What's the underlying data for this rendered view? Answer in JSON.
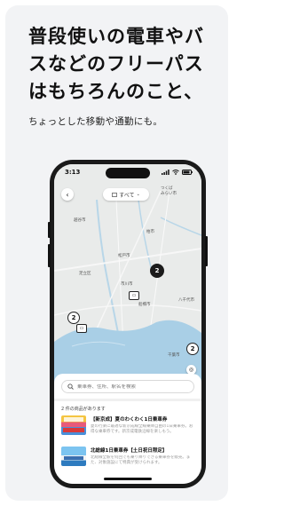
{
  "headline": {
    "line1": "普段使いの電車やバ",
    "line2": "スなどのフリーパス",
    "line3": "はもちろんのこと、"
  },
  "subline": "ちょっとした移動や通勤にも。",
  "phone": {
    "status_time": "3:13",
    "filter_label": "すべて",
    "map_places": {
      "tsukuba": "つくば\nみらい市",
      "koshigaya": "越谷市",
      "kashiwa": "柏市",
      "matsudo": "松戸市",
      "adachi": "足立区",
      "ichikawa": "市川市",
      "funabashi": "船橋市",
      "yachiyo": "八千代市",
      "chiba": "千葉市"
    },
    "clusters": [
      "2",
      "2",
      "2"
    ],
    "search_placeholder": "乗車券、住所、駅名を検索",
    "results_count": "2 件の商品があります",
    "items": [
      {
        "title": "【新京成】夏のわくわく1日乗車券",
        "desc": "夏の行楽に最適な新京成線全線乗降自由の1日乗車券。お得な乗車券です。新京成電鉄沿線を楽しもう。"
      },
      {
        "title": "北総線1日乗車券【土日祝日限定】",
        "desc": "北総線全駅を何回でも乗り降りできる乗車券を販売。また、対象施設にて特典が受けられます。"
      }
    ],
    "colors": {
      "map_water": "#a9cfe6",
      "map_land": "#e9ebea",
      "cluster_dark": "#1b1b1b"
    }
  }
}
